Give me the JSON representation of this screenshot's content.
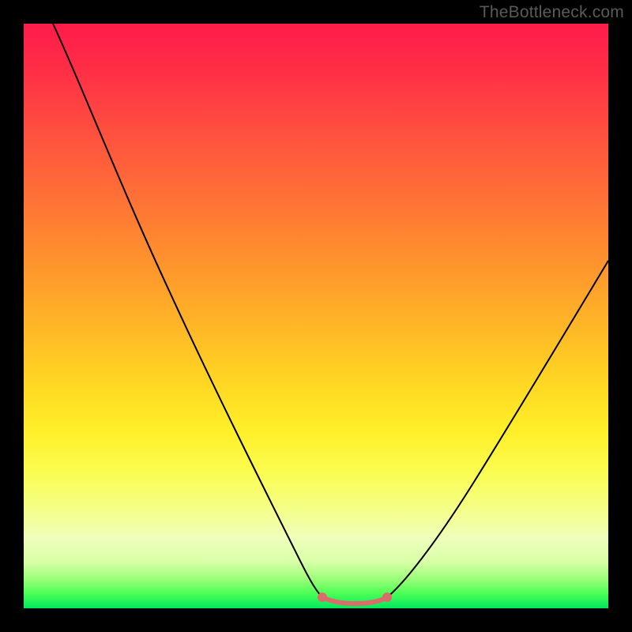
{
  "watermark": "TheBottleneck.com",
  "chart_data": {
    "type": "line",
    "title": "",
    "xlabel": "",
    "ylabel": "",
    "xlim": [
      0,
      100
    ],
    "ylim": [
      0,
      100
    ],
    "gradient_stops": [
      {
        "pos": 0,
        "color": "#ff1b4b"
      },
      {
        "pos": 8,
        "color": "#ff2f46"
      },
      {
        "pos": 22,
        "color": "#ff5a3d"
      },
      {
        "pos": 38,
        "color": "#ff8a2f"
      },
      {
        "pos": 52,
        "color": "#ffb726"
      },
      {
        "pos": 62,
        "color": "#ffd923"
      },
      {
        "pos": 70,
        "color": "#fff02a"
      },
      {
        "pos": 77,
        "color": "#fafd52"
      },
      {
        "pos": 83,
        "color": "#f4ff88"
      },
      {
        "pos": 88,
        "color": "#eeffba"
      },
      {
        "pos": 92,
        "color": "#d9ffa8"
      },
      {
        "pos": 95,
        "color": "#9bff79"
      },
      {
        "pos": 97.5,
        "color": "#4bff56"
      },
      {
        "pos": 100,
        "color": "#00e85e"
      }
    ],
    "series": [
      {
        "name": "left-curve",
        "description": "descending black curve from top-left to valley",
        "points_xy": [
          [
            5,
            100
          ],
          [
            8,
            95
          ],
          [
            12,
            88
          ],
          [
            16,
            80
          ],
          [
            20,
            71
          ],
          [
            25,
            60
          ],
          [
            30,
            48
          ],
          [
            35,
            36
          ],
          [
            40,
            24
          ],
          [
            45,
            12
          ],
          [
            48,
            6
          ],
          [
            50,
            3
          ]
        ]
      },
      {
        "name": "valley-flat",
        "description": "red flat segment with end markers at the bottom",
        "points_xy": [
          [
            50,
            2
          ],
          [
            62,
            2
          ]
        ]
      },
      {
        "name": "right-curve",
        "description": "ascending black curve from valley to right edge",
        "points_xy": [
          [
            62,
            3
          ],
          [
            66,
            7
          ],
          [
            70,
            12
          ],
          [
            75,
            20
          ],
          [
            80,
            29
          ],
          [
            85,
            38
          ],
          [
            90,
            47
          ],
          [
            95,
            56
          ],
          [
            100,
            64
          ]
        ]
      }
    ],
    "markers": [
      {
        "x": 50,
        "y": 2,
        "color": "#e06666"
      },
      {
        "x": 62,
        "y": 2,
        "color": "#e06666"
      }
    ]
  }
}
